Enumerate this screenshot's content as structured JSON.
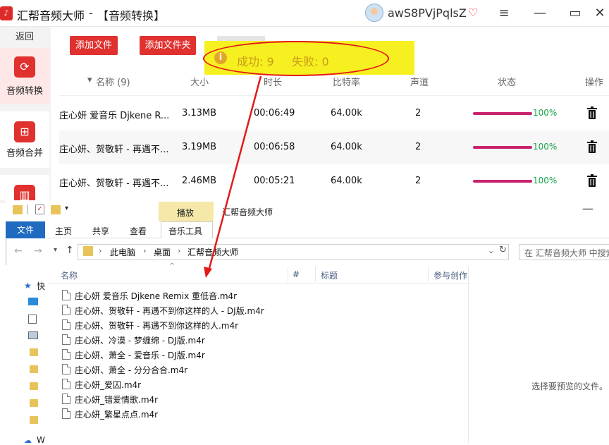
{
  "app": {
    "title": "汇帮音频大师",
    "separator": "-",
    "mode": "【音频转换】",
    "user_name": "awS8PVjPqlsZ",
    "window_controls": [
      "menu-icon",
      "minimize-icon",
      "maximize-icon",
      "close-icon"
    ]
  },
  "sidebar": {
    "back": "返回",
    "items": [
      {
        "label": "音频转换",
        "icon": "audio-convert-icon",
        "active": true
      },
      {
        "label": "音频合并",
        "icon": "audio-merge-icon",
        "active": false
      },
      {
        "label": "",
        "icon": "audio-edit-icon",
        "active": false
      }
    ]
  },
  "toolbar": {
    "add_file": "添加文件",
    "add_folder": "添加文件夹"
  },
  "notice": {
    "success": "成功: 9",
    "fail": "失败: 0",
    "annotation_color": "#e21a1a"
  },
  "list": {
    "columns": [
      "名称 (9)",
      "大小",
      "时长",
      "比特率",
      "声道",
      "状态",
      "操作"
    ],
    "rows": [
      {
        "name": "庄心妍 爱音乐 Djkene R...",
        "size": "3.13MB",
        "duration": "00:06:49",
        "bitrate": "64.00k",
        "channels": "2",
        "progress": "100%"
      },
      {
        "name": "庄心妍、贺敬轩 - 再遇不...",
        "size": "3.19MB",
        "duration": "00:06:58",
        "bitrate": "64.00k",
        "channels": "2",
        "progress": "100%"
      },
      {
        "name": "庄心妍、贺敬轩 - 再遇不...",
        "size": "2.46MB",
        "duration": "00:05:21",
        "bitrate": "64.00k",
        "channels": "2",
        "progress": "100%"
      }
    ],
    "progress_color": "#c9236c",
    "percent_color": "#17a34a"
  },
  "explorer": {
    "title": "汇帮音频大师",
    "play_tab": "播放",
    "ribbon": {
      "file": "文件",
      "tabs": [
        "主页",
        "共享",
        "查看",
        "音乐工具"
      ]
    },
    "breadcrumb": [
      "此电脑",
      "桌面",
      "汇帮音频大师"
    ],
    "search_placeholder": "在 汇帮音频大师 中搜索",
    "columns": [
      "名称",
      "#",
      "标题",
      "参与创作"
    ],
    "nav_items": [
      "快",
      "",
      "",
      "",
      "",
      "",
      "",
      "",
      "",
      "W"
    ],
    "files": [
      "庄心妍 爱音乐 Djkene Remix 重低音.m4r",
      "庄心妍、贺敬轩 - 再遇不到你这样的人 - DJ版.m4r",
      "庄心妍、贺敬轩 - 再遇不到你这样的人.m4r",
      "庄心妍、冷漠 - 梦缠绵 - DJ版.m4r",
      "庄心妍、萧全 - 爱音乐 - DJ版.m4r",
      "庄心妍、萧全 - 分分合合.m4r",
      "庄心妍_爱囚.m4r",
      "庄心妍_错爱情歌.m4r",
      "庄心妍_繁星点点.m4r"
    ],
    "preview_text": "选择要预览的文件。"
  }
}
